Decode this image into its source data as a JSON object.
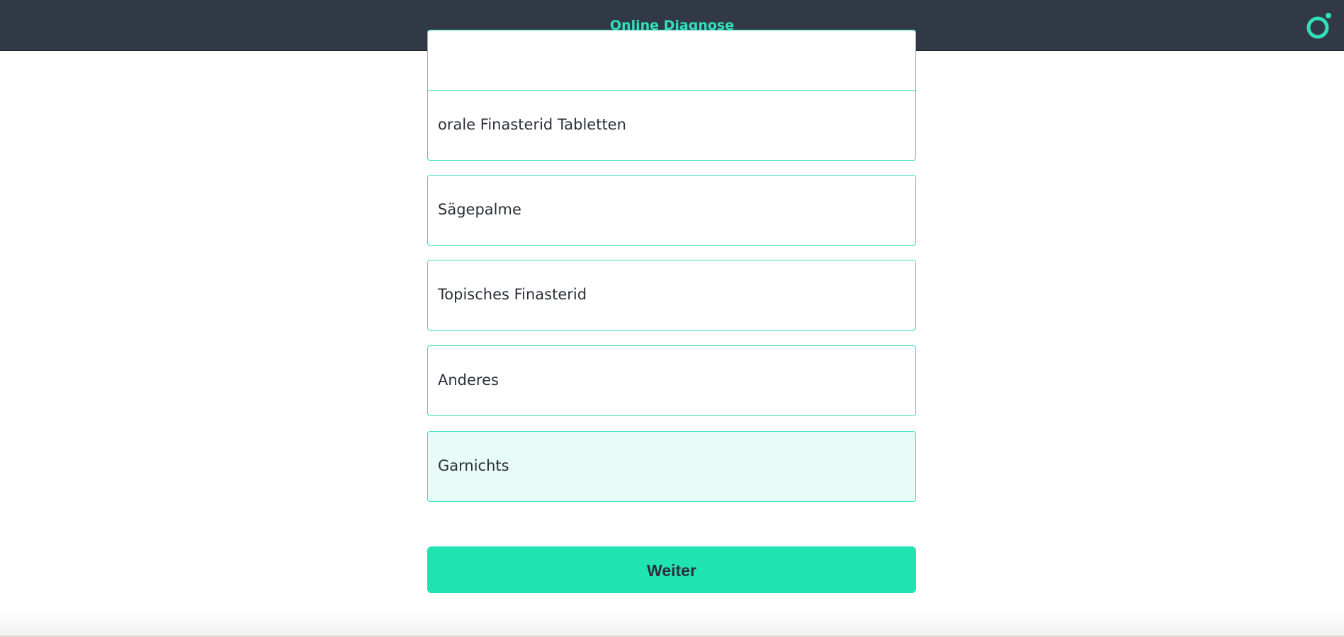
{
  "header": {
    "title": "Online Diagnose",
    "logo_icon": "ring-dot-logo-icon"
  },
  "options": [
    {
      "label": "",
      "selected": false
    },
    {
      "label": "orale Finasterid Tabletten",
      "selected": false
    },
    {
      "label": "Sägepalme",
      "selected": false
    },
    {
      "label": "Topisches Finasterid",
      "selected": false
    },
    {
      "label": "Anderes",
      "selected": false
    },
    {
      "label": "Garnichts",
      "selected": true
    }
  ],
  "actions": {
    "next_label": "Weiter"
  },
  "colors": {
    "header_bg": "#323946",
    "accent": "#2fe0bd",
    "button_bg": "#20e3b2",
    "selected_bg": "#e8fcf7"
  }
}
